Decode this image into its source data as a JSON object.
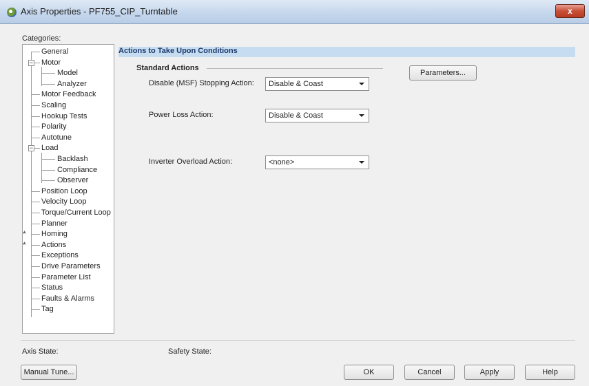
{
  "window": {
    "title": "Axis Properties - PF755_CIP_Turntable",
    "close_label": "x"
  },
  "categories_label": "Categories:",
  "tree": {
    "items": [
      {
        "label": "General"
      },
      {
        "label": "Motor",
        "expander": "−"
      },
      {
        "label": "Model"
      },
      {
        "label": "Analyzer"
      },
      {
        "label": "Motor Feedback"
      },
      {
        "label": "Scaling"
      },
      {
        "label": "Hookup Tests"
      },
      {
        "label": "Polarity"
      },
      {
        "label": "Autotune"
      },
      {
        "label": "Load",
        "expander": "−"
      },
      {
        "label": "Backlash"
      },
      {
        "label": "Compliance"
      },
      {
        "label": "Observer"
      },
      {
        "label": "Position Loop"
      },
      {
        "label": "Velocity Loop"
      },
      {
        "label": "Torque/Current Loop"
      },
      {
        "label": "Planner"
      },
      {
        "label": "Homing",
        "marker": "*"
      },
      {
        "label": "Actions",
        "marker": "*"
      },
      {
        "label": "Exceptions"
      },
      {
        "label": "Drive Parameters"
      },
      {
        "label": "Parameter List"
      },
      {
        "label": "Status"
      },
      {
        "label": "Faults & Alarms"
      },
      {
        "label": "Tag"
      }
    ]
  },
  "panel": {
    "header": "Actions to Take Upon Conditions",
    "group_title": "Standard Actions",
    "parameters_button": "Parameters...",
    "fields": {
      "disable": {
        "label": "Disable (MSF) Stopping Action:",
        "value": "Disable & Coast"
      },
      "power_loss": {
        "label": "Power Loss Action:",
        "value": "Disable & Coast"
      },
      "inverter_overload": {
        "label": "Inverter Overload Action:",
        "value": "<none>"
      }
    }
  },
  "status": {
    "axis_state_label": "Axis State:",
    "safety_state_label": "Safety State:"
  },
  "buttons": {
    "manual_tune": "Manual Tune...",
    "ok": "OK",
    "cancel": "Cancel",
    "apply": "Apply",
    "help": "Help"
  },
  "colors": {
    "header_bar": "#c6dcf0",
    "title_bar": "#c4d6ec",
    "close_button": "#c75037"
  }
}
